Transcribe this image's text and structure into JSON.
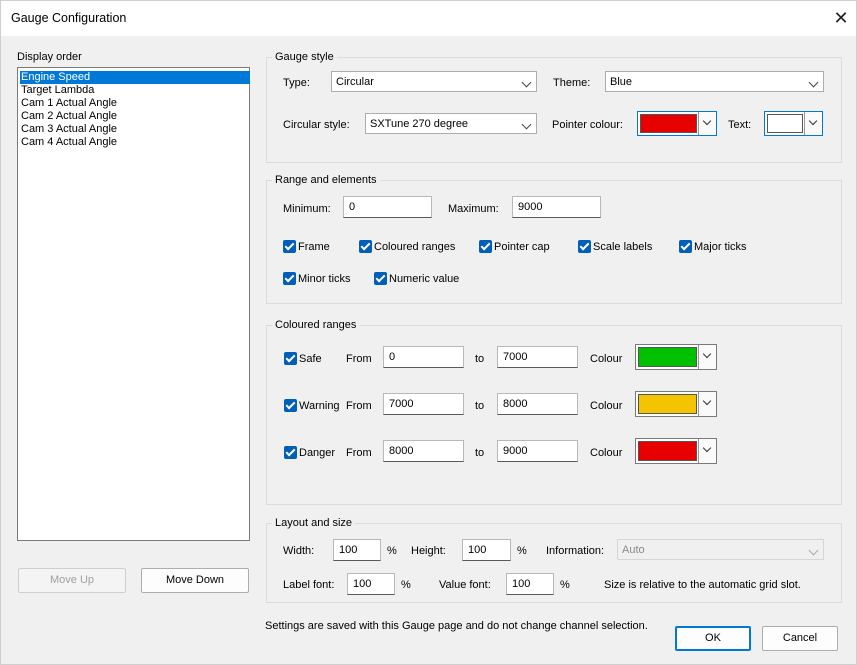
{
  "window": {
    "title": "Gauge Configuration"
  },
  "display_order": {
    "label": "Display order",
    "items": [
      "Engine Speed",
      "Target Lambda",
      "Cam 1 Actual Angle",
      "Cam 2 Actual Angle",
      "Cam 3 Actual Angle",
      "Cam 4 Actual Angle"
    ],
    "selected": "Engine Speed",
    "move_up_label": "Move Up",
    "move_down_label": "Move Down"
  },
  "gauge_style": {
    "group_title": "Gauge style",
    "type_label": "Type:",
    "type_value": "Circular",
    "theme_label": "Theme:",
    "theme_value": "Blue",
    "circular_style_label": "Circular style:",
    "circular_style_value": "SXTune 270 degree",
    "pointer_colour_label": "Pointer colour:",
    "pointer_colour": "#e60000",
    "text_label": "Text:",
    "text_colour": "#ffffff"
  },
  "range_elements": {
    "group_title": "Range and elements",
    "minimum_label": "Minimum:",
    "minimum_value": "0",
    "maximum_label": "Maximum:",
    "maximum_value": "9000",
    "checkboxes": [
      {
        "label": "Frame",
        "checked": true
      },
      {
        "label": "Coloured ranges",
        "checked": true
      },
      {
        "label": "Pointer cap",
        "checked": true
      },
      {
        "label": "Scale labels",
        "checked": true
      },
      {
        "label": "Major ticks",
        "checked": true
      },
      {
        "label": "Minor ticks",
        "checked": true
      },
      {
        "label": "Numeric value",
        "checked": true
      }
    ]
  },
  "coloured_ranges": {
    "group_title": "Coloured ranges",
    "from_label": "From",
    "to_label": "to",
    "colour_label": "Colour",
    "rows": [
      {
        "name": "Safe",
        "checked": true,
        "from": "0",
        "to": "7000",
        "colour": "#00c000"
      },
      {
        "name": "Warning",
        "checked": true,
        "from": "7000",
        "to": "8000",
        "colour": "#f5c400"
      },
      {
        "name": "Danger",
        "checked": true,
        "from": "8000",
        "to": "9000",
        "colour": "#e60000"
      }
    ]
  },
  "layout_size": {
    "group_title": "Layout and size",
    "width_label": "Width:",
    "width_value": "100",
    "height_label": "Height:",
    "height_value": "100",
    "percent": "%",
    "information_label": "Information:",
    "information_value": "Auto",
    "label_font_label": "Label font:",
    "label_font_value": "100",
    "value_font_label": "Value font:",
    "value_font_value": "100",
    "note": "Size is relative to the automatic grid slot."
  },
  "footer": {
    "note": "Settings are saved with this Gauge page and do not change channel selection.",
    "ok_label": "OK",
    "cancel_label": "Cancel"
  }
}
